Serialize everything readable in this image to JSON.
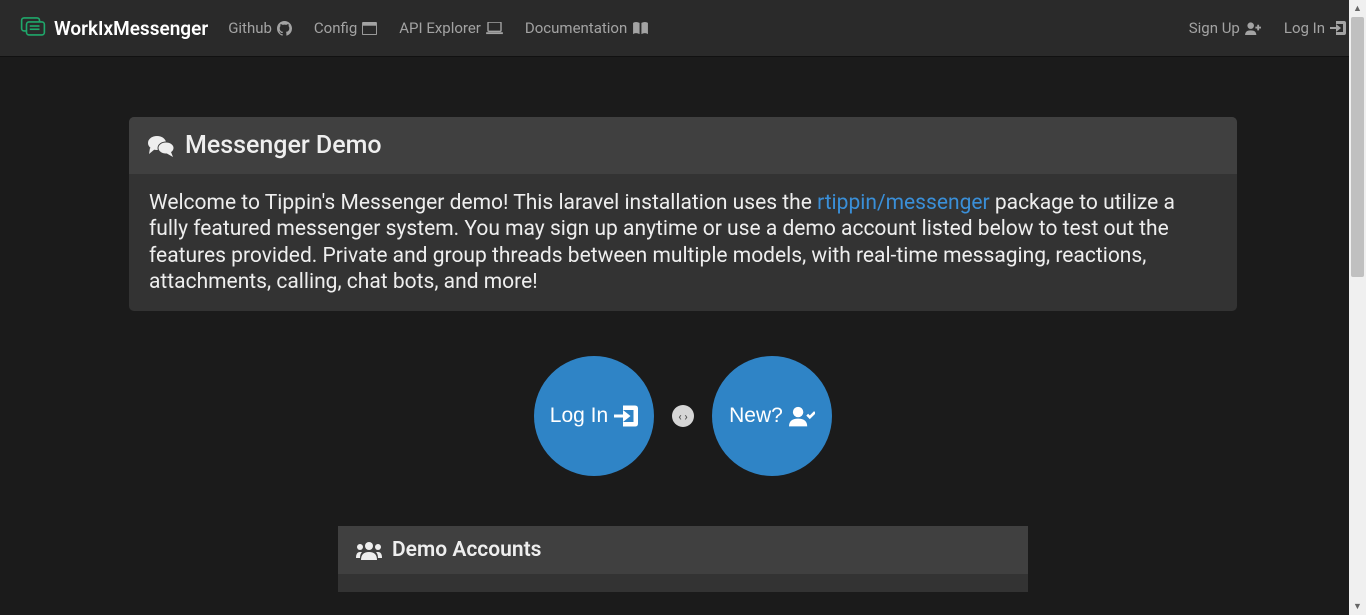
{
  "brand": "WorkIxMessenger",
  "nav": {
    "github": "Github",
    "config": "Config",
    "api_explorer": "API Explorer",
    "documentation": "Documentation",
    "sign_up": "Sign Up",
    "log_in": "Log In"
  },
  "hero": {
    "title": "Messenger Demo",
    "welcome_before": "Welcome to Tippin's Messenger demo! This laravel installation uses the ",
    "welcome_link": "rtippin/messenger",
    "welcome_after": " package to utilize a fully featured messenger system. You may sign up anytime or use a demo account listed below to test out the features provided. Private and group threads between multiple models, with real-time messaging, reactions, attachments, calling, chat bots, and more!"
  },
  "buttons": {
    "login": "Log In",
    "new": "New?",
    "divider": "‹ ›"
  },
  "demo_section": {
    "title": "Demo Accounts"
  }
}
